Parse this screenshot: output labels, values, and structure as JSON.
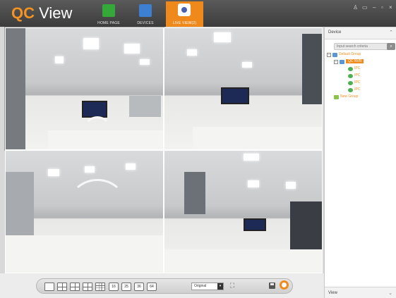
{
  "app": {
    "logo_qc": "QC",
    "logo_view": " View"
  },
  "nav": {
    "home_label": "HOME PAGE",
    "devices_label": "DEVICES",
    "live_label": "LIVE VIEW(2)"
  },
  "window_controls": {
    "user": "♙",
    "lock": "▭",
    "minimize": "–",
    "maximize": "▫",
    "close": "×"
  },
  "panel": {
    "title": "Device",
    "search_placeholder": "Input search criteria",
    "tree": {
      "default_group": "Default Group",
      "nvr": "QC NVR",
      "cameras": [
        "IPC",
        "IPC",
        "IPC",
        "IPC"
      ],
      "new_group": "New Group"
    },
    "view_label": "View"
  },
  "toolbar": {
    "split_16": "16",
    "split_25": "25",
    "split_36": "36",
    "split_64": "64",
    "aspect_value": "Original"
  },
  "colors": {
    "accent": "#f0891b",
    "titlebar": "#464646"
  },
  "icons": [
    "home-icon",
    "devices-icon",
    "live-view-icon",
    "user-icon",
    "lock-icon",
    "minimize-icon",
    "maximize-icon",
    "close-icon",
    "search-icon",
    "save-icon",
    "record-icon",
    "fullscreen-icon"
  ]
}
